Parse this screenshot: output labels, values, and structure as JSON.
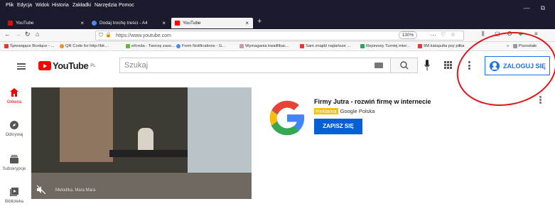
{
  "browser": {
    "menu": [
      "Plik",
      "Edycja",
      "Widok",
      "Historia",
      "Zakładki",
      "Narzędzia",
      "Pomoc"
    ],
    "tabs": [
      {
        "title": "YouTube",
        "active": false
      },
      {
        "title": "Dodaj trochę treści - A4",
        "active": false
      },
      {
        "title": "YouTube",
        "active": true
      }
    ],
    "url": "https://www.youtube.com",
    "zoom": "130%",
    "bookmarks": [
      "Śpiewające Brzdące - ...",
      "QR Code for http://bit....",
      "eKreda - Tworzę zaso...",
      "Form Notifications - G...",
      "Wymagania kwalifikac...",
      "Sam znajdź najtańsze ...",
      "Rejonowy Turniej inter...",
      "9M katapulta psy piłka"
    ],
    "bookmarks_more": "Pozostałe"
  },
  "youtube": {
    "logo_text": "YouTube",
    "logo_region": "PL",
    "search_placeholder": "Szukaj",
    "signin_label": "ZALOGUJ SIĘ",
    "sidebar": [
      {
        "label": "Główna",
        "icon": "home-icon",
        "active": true
      },
      {
        "label": "Odkrywaj",
        "icon": "compass-icon",
        "active": false
      },
      {
        "label": "Subskrypcje",
        "icon": "subscriptions-icon",
        "active": false
      },
      {
        "label": "Biblioteka",
        "icon": "library-icon",
        "active": false
      }
    ],
    "video_caption": "Melodika, Mara Mara",
    "ad": {
      "title": "Firmy Jutra - rozwiń firmę w internecie",
      "badge": "Reklama",
      "advertiser": "Google Polska",
      "cta": "ZAPISZ SIĘ"
    }
  },
  "colors": {
    "accent": "#1a73e8",
    "youtube_red": "#ff0000",
    "annotation": "#e0151c"
  }
}
